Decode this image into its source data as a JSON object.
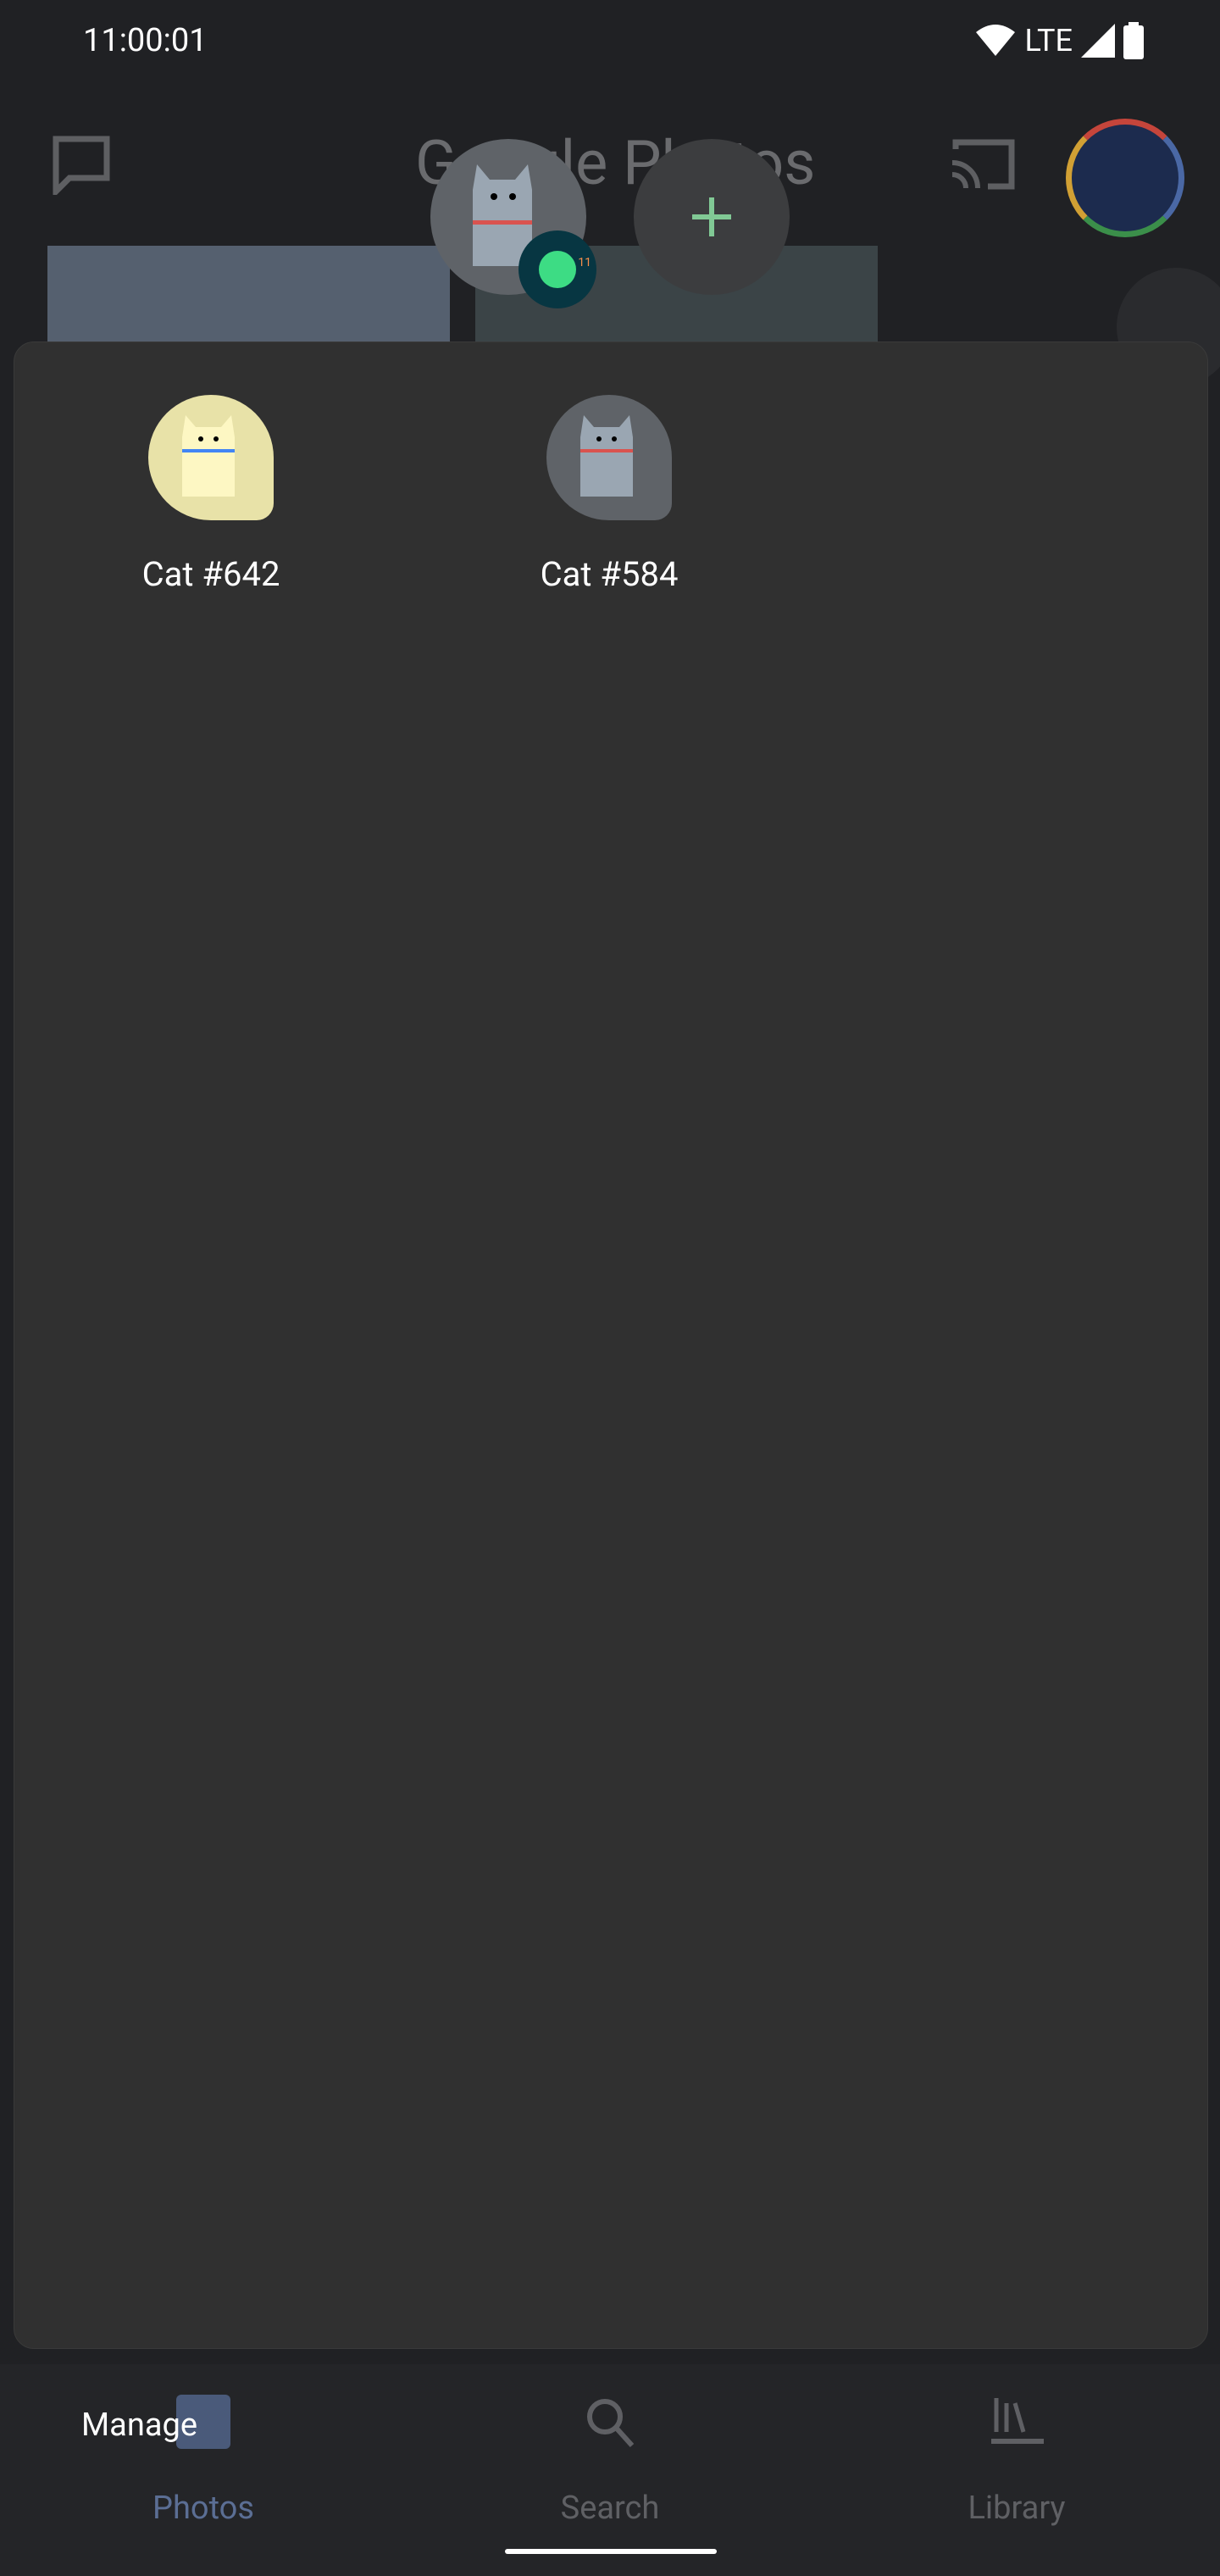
{
  "status_bar": {
    "time": "11:00:01",
    "network": "LTE",
    "icons": [
      "wifi-icon",
      "signal-icon",
      "battery-icon"
    ]
  },
  "app_bar": {
    "title": "Google Photos",
    "icons": [
      "message-icon",
      "cast-icon",
      "avatar"
    ]
  },
  "bubbles": {
    "cat_bubble_badge": "11",
    "add_icon": "plus-icon",
    "accent": "#81c995"
  },
  "panel": {
    "cats": [
      {
        "label": "Cat #642",
        "color": "#e8e2a8"
      },
      {
        "label": "Cat #584",
        "color": "#5f6368"
      }
    ]
  },
  "manage_label": "Manage",
  "nav": {
    "tabs": [
      {
        "label": "Photos",
        "active": true
      },
      {
        "label": "Search",
        "active": false
      },
      {
        "label": "Library",
        "active": false
      }
    ],
    "active_color": "#5b6e94",
    "inactive_color": "#5f6064"
  }
}
